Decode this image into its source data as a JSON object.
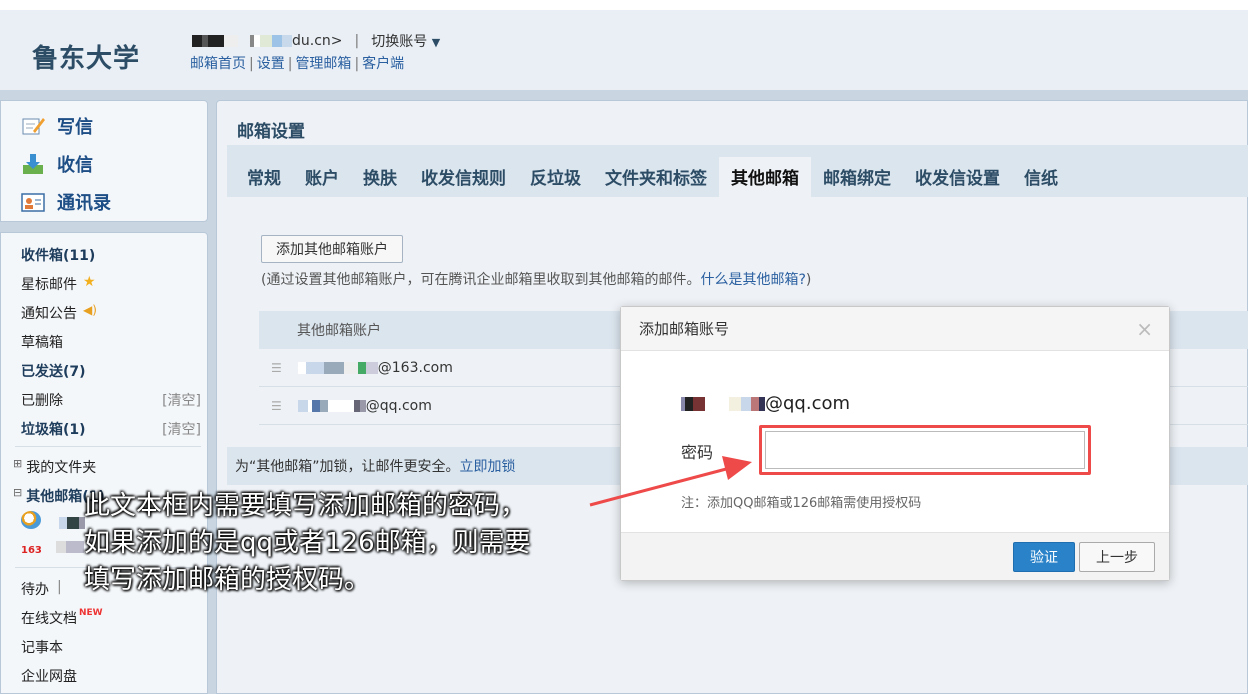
{
  "header": {
    "logo": "鲁东大学",
    "account_suffix": "du.cn>",
    "separator": "|",
    "switch_account": "切换账号",
    "links": [
      "邮箱首页",
      "设置",
      "管理邮箱",
      "客户端"
    ]
  },
  "sidebar": {
    "commands": [
      {
        "label": "写信",
        "icon": "compose-icon"
      },
      {
        "label": "收信",
        "icon": "inbox-download-icon"
      },
      {
        "label": "通讯录",
        "icon": "contacts-icon"
      }
    ],
    "folders": [
      {
        "label": "收件箱(11)",
        "bold": true,
        "right": ""
      },
      {
        "label": "星标邮件",
        "bold": false,
        "right": "",
        "icon": "star-icon"
      },
      {
        "label": "通知公告",
        "bold": false,
        "right": "",
        "icon": "speaker-icon"
      },
      {
        "label": "草稿箱",
        "bold": false,
        "right": ""
      },
      {
        "label": "已发送(7)",
        "bold": true,
        "right": ""
      },
      {
        "label": "已删除",
        "bold": false,
        "right": "[清空]"
      },
      {
        "label": "垃圾箱(1)",
        "bold": true,
        "right": "[清空]"
      }
    ],
    "my_folders": "我的文件夹",
    "other_mailboxes": "其他邮箱(1)",
    "tools": [
      {
        "label": "待办",
        "extra": "|"
      },
      {
        "label": "在线文档",
        "badge": "NEW"
      },
      {
        "label": "记事本"
      },
      {
        "label": "企业网盘"
      }
    ]
  },
  "main": {
    "title": "邮箱设置",
    "tabs": [
      "常规",
      "账户",
      "换肤",
      "收发信规则",
      "反垃圾",
      "文件夹和标签",
      "其他邮箱",
      "邮箱绑定",
      "收发信设置",
      "信纸"
    ],
    "active_tab": "其他邮箱",
    "add_button": "添加其他邮箱账户",
    "hint_prefix": "(通过设置其他邮箱账户，可在腾讯企业邮箱里收取到其他邮箱的邮件。",
    "hint_link": "什么是其他邮箱?",
    "hint_suffix": ")",
    "table_header": "其他邮箱账户",
    "accounts": [
      "@163.com",
      "@qq.com"
    ],
    "lock_text": "为“其他邮箱”加锁，让邮件更安全。",
    "lock_link": "立即加锁"
  },
  "dialog": {
    "title": "添加邮箱账号",
    "close": "×",
    "email_suffix": "@qq.com",
    "password_label": "密码",
    "password_value": "",
    "note": "注：添加QQ邮箱或126邮箱需使用授权码",
    "verify_button": "验证",
    "back_button": "上一步"
  },
  "annotation": {
    "lines": [
      "此文本框内需要填写添加邮箱的密码，",
      "如果添加的是qq或者126邮箱，则需要",
      "填写添加邮箱的授权码。"
    ],
    "color": "#ef4a4a"
  }
}
